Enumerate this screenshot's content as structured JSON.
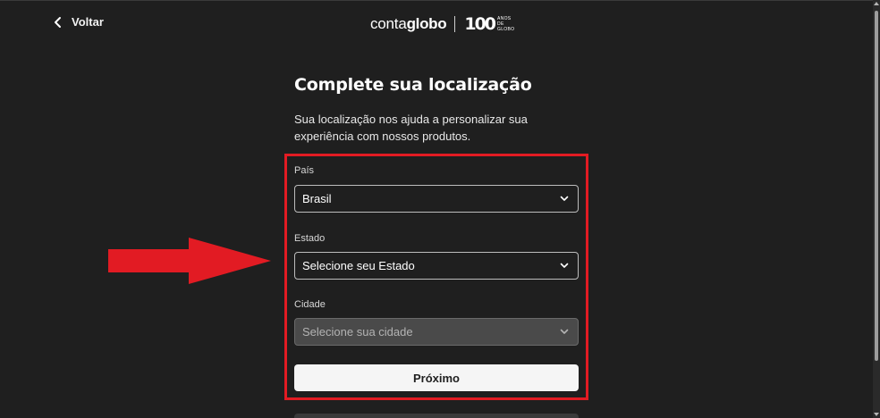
{
  "header": {
    "back_label": "Voltar",
    "logo": {
      "conta": "conta",
      "globo": "globo",
      "hundred": "100",
      "anos_line1": "ANOS",
      "anos_line2": "DE",
      "anos_line3": "GLOBO"
    }
  },
  "main": {
    "title": "Complete sua localização",
    "description": "Sua localização nos ajuda a personalizar sua experiência com nossos produtos.",
    "fields": {
      "pais": {
        "label": "País",
        "value": "Brasil"
      },
      "estado": {
        "label": "Estado",
        "value": "Selecione seu Estado"
      },
      "cidade": {
        "label": "Cidade",
        "value": "Selecione sua cidade"
      }
    },
    "next_button": "Próximo"
  },
  "colors": {
    "background": "#1f1f1f",
    "highlight": "#e21b23",
    "arrow": "#e21b23",
    "button_bg": "#f5f5f5"
  },
  "icons": {
    "back": "chevron-left-icon",
    "dropdown": "chevron-down-icon"
  }
}
